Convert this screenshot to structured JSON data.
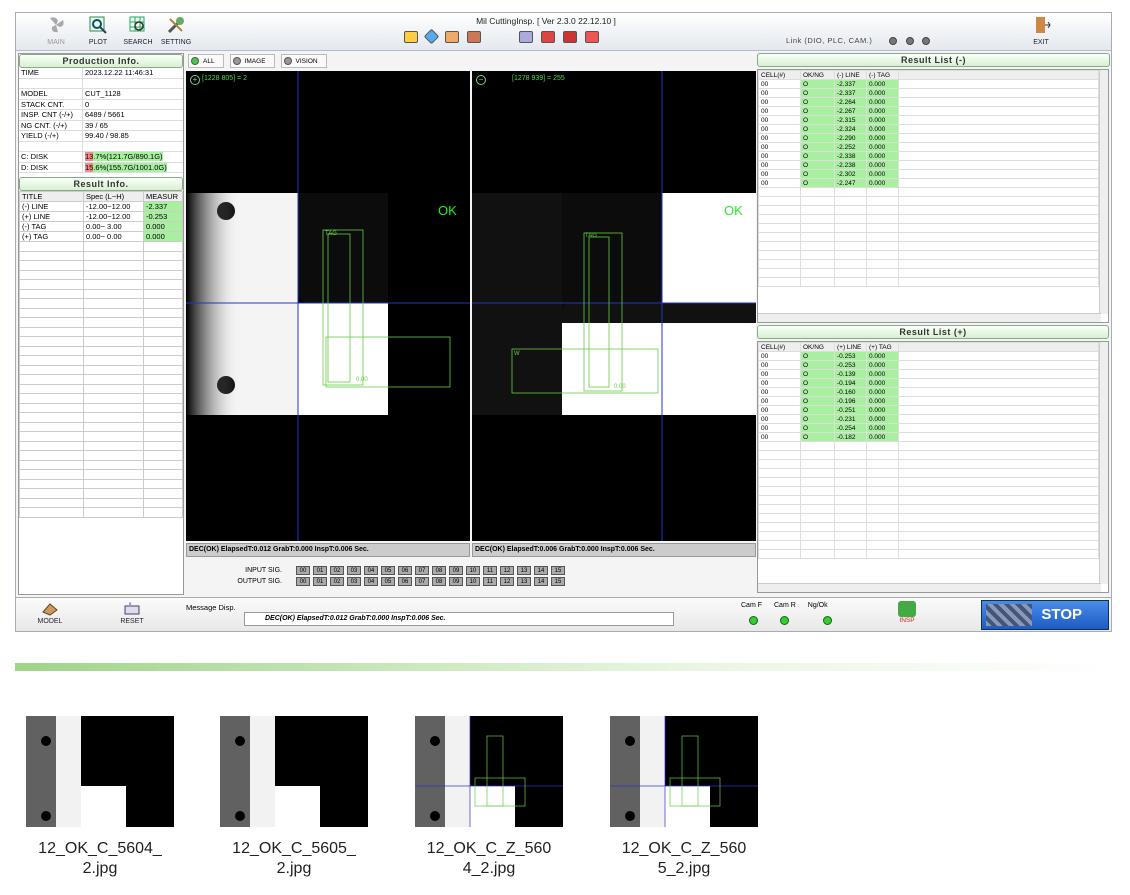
{
  "titlebar": {
    "title": "Mil CuttingInsp. [ Ver 2.3.0  22.12.10 ]",
    "buttons": [
      "MAIN",
      "PLOT",
      "SEARCH",
      "SETTING"
    ],
    "link_label": "Link (DIO, PLC, CAM.)",
    "exit_label": "EXIT"
  },
  "production": {
    "header": "Production Info.",
    "rows": [
      {
        "k": "TIME",
        "v": "2023.12.22  11:46:31"
      },
      {
        "k": "",
        "v": ""
      },
      {
        "k": "MODEL",
        "v": "CUT_1128"
      },
      {
        "k": "STACK CNT.",
        "v": "0"
      },
      {
        "k": "INSP. CNT (-/+)",
        "v": "6489 / 5661"
      },
      {
        "k": "NG CNT. (-/+)",
        "v": "39 / 65"
      },
      {
        "k": "YIELD (-/+)",
        "v": "99.40 / 98.85"
      },
      {
        "k": "",
        "v": ""
      },
      {
        "k": "C: DISK",
        "v_red": "13",
        "v": ".7%(121.7G/890.1G)"
      },
      {
        "k": "D: DISK",
        "v_red": "15",
        "v": ".6%(155.7G/1001.0G)"
      }
    ]
  },
  "result_info": {
    "header": "Result Info.",
    "columns": [
      "TITLE",
      "Spec (L~H)",
      "MEASUR"
    ],
    "rows": [
      [
        "(-) LINE",
        "-12.00~12.00",
        "-2.337"
      ],
      [
        "(+) LINE",
        "-12.00~12.00",
        "-0.253"
      ],
      [
        "(-) TAG",
        "0.00~ 3.00",
        "0.000"
      ],
      [
        "(+) TAG",
        "0.00~ 0.00",
        "0.000"
      ]
    ]
  },
  "view_tabs": [
    "ALL",
    "IMAGE",
    "VISION"
  ],
  "cam_left": {
    "header": "[1228  805] = 2",
    "result": "OK",
    "status": "DEC(OK)  ElapsedT:0.012  GrabT:0.000 InspT:0.006 Sec."
  },
  "cam_right": {
    "header": "[1278  939] = 255",
    "result": "OK",
    "status": "DEC(OK)  ElapsedT:0.006  GrabT:0.000 InspT:0.006 Sec."
  },
  "overlay_labels": {
    "tag": "TAG",
    "val": "0.00",
    "w": "W"
  },
  "signals": {
    "input_label": "INPUT  SIG.",
    "output_label": "OUTPUT SIG.",
    "bits": [
      "00",
      "01",
      "02",
      "03",
      "04",
      "05",
      "06",
      "07",
      "08",
      "09",
      "10",
      "11",
      "12",
      "13",
      "14",
      "15"
    ]
  },
  "result_minus": {
    "header": "Result List (-)",
    "columns": [
      "CELL(#)",
      "OK/NG",
      "(-) LINE",
      "(-) TAG"
    ],
    "rows": [
      [
        "00",
        "O",
        "-2.337",
        "0.000"
      ],
      [
        "00",
        "O",
        "-2.337",
        "0.000"
      ],
      [
        "00",
        "O",
        "-2.264",
        "0.000"
      ],
      [
        "00",
        "O",
        "-2.267",
        "0.000"
      ],
      [
        "00",
        "O",
        "-2.315",
        "0.000"
      ],
      [
        "00",
        "O",
        "-2.324",
        "0.000"
      ],
      [
        "00",
        "O",
        "-2.290",
        "0.000"
      ],
      [
        "00",
        "O",
        "-2.252",
        "0.000"
      ],
      [
        "00",
        "O",
        "-2.338",
        "0.000"
      ],
      [
        "00",
        "O",
        "-2.238",
        "0.000"
      ],
      [
        "00",
        "O",
        "-2.302",
        "0.000"
      ],
      [
        "00",
        "O",
        "-2.247",
        "0.000"
      ]
    ]
  },
  "result_plus": {
    "header": "Result List (+)",
    "columns": [
      "CELL(#)",
      "OK/NG",
      "(+) LINE",
      "(+) TAG"
    ],
    "rows": [
      [
        "00",
        "O",
        "-0.253",
        "0.000"
      ],
      [
        "00",
        "O",
        "-0.253",
        "0.000"
      ],
      [
        "00",
        "O",
        "-0.139",
        "0.000"
      ],
      [
        "00",
        "O",
        "-0.194",
        "0.000"
      ],
      [
        "00",
        "O",
        "-0.160",
        "0.000"
      ],
      [
        "00",
        "O",
        "-0.196",
        "0.000"
      ],
      [
        "00",
        "O",
        "-0.251",
        "0.000"
      ],
      [
        "00",
        "O",
        "-0.231",
        "0.000"
      ],
      [
        "00",
        "O",
        "-0.254",
        "0.000"
      ],
      [
        "00",
        "O",
        "-0.182",
        "0.000"
      ]
    ]
  },
  "bottom": {
    "model_label": "MODEL",
    "reset_label": "RESET",
    "msg_label": "Message Disp.",
    "msg_text": "DEC(OK)  ElapsedT:0.012  GrabT:0.000 InspT:0.006 Sec.",
    "indicators": [
      "Cam F",
      "Cam R",
      "Ng/Ok"
    ],
    "insp_label": "INSP",
    "stop_label": "STOP"
  },
  "files": [
    {
      "line1": "12_OK_C_5604_",
      "line2": "2.jpg"
    },
    {
      "line1": "12_OK_C_5605_",
      "line2": "2.jpg"
    },
    {
      "line1": "12_OK_C_Z_560",
      "line2": "4_2.jpg"
    },
    {
      "line1": "12_OK_C_Z_560",
      "line2": "5_2.jpg"
    }
  ],
  "colors": {
    "ok_green": "#22ee22",
    "pass_cell": "#a8f0a0",
    "disk_warn": "#f48b8b",
    "stop_blue": "#1c5cc4"
  }
}
